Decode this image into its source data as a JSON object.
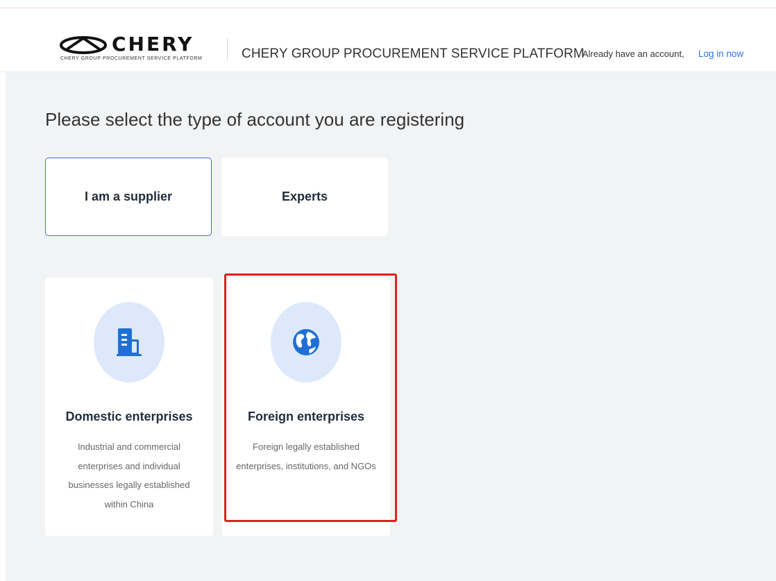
{
  "header": {
    "logo_word": "CHERY",
    "logo_subtitle": "CHERY GROUP PROCUREMENT SERVICE PLATFORM",
    "platform_title": "CHERY GROUP PROCUREMENT SERVICE PLATFORM",
    "account_prompt": "Already have an account,",
    "login_link": "Log in now"
  },
  "main": {
    "heading": "Please select the type of account you are registering",
    "account_types": [
      {
        "label": "I am a supplier",
        "selected": true
      },
      {
        "label": "Experts",
        "selected": false
      }
    ],
    "enterprise_types": [
      {
        "icon": "building-icon",
        "title": "Domestic enterprises",
        "description": "Industrial and commercial enterprises and individual businesses legally established within China"
      },
      {
        "icon": "globe-icon",
        "title": "Foreign enterprises",
        "description": "Foreign legally established enterprises, institutions, and NGOs",
        "highlighted": true
      }
    ]
  },
  "colors": {
    "accent": "#2f6fe0",
    "selected_border": "#3b6fd6",
    "highlight": "#e02020",
    "icon_bg": "#dde9fb",
    "icon_fg": "#1f6fd6",
    "page_bg": "#f2f3f5"
  }
}
